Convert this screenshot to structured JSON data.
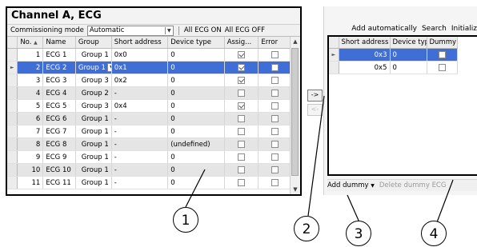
{
  "left_panel": {
    "title": "Channel A, ECG",
    "mode_label": "Commissioning mode",
    "mode_value": "Automatic",
    "all_on_label": "All ECG ON",
    "all_off_label": "All ECG OFF",
    "columns": [
      "No.",
      "Name",
      "Group",
      "Short address",
      "Device type",
      "Assig...",
      "Error"
    ],
    "rows": [
      {
        "no": "1",
        "name": "ECG 1",
        "group": "Group 1",
        "short_address": "0x0",
        "device_type": "0",
        "assigned": true,
        "error": false,
        "selected": false,
        "grey": false
      },
      {
        "no": "2",
        "name": "ECG 2",
        "group": "Group 1",
        "short_address": "0x1",
        "device_type": "0",
        "assigned": true,
        "error": false,
        "selected": true,
        "grey": false
      },
      {
        "no": "3",
        "name": "ECG 3",
        "group": "Group 3",
        "short_address": "0x2",
        "device_type": "0",
        "assigned": true,
        "error": false,
        "selected": false,
        "grey": false
      },
      {
        "no": "4",
        "name": "ECG 4",
        "group": "Group 2",
        "short_address": "-",
        "device_type": "0",
        "assigned": false,
        "error": false,
        "selected": false,
        "grey": true
      },
      {
        "no": "5",
        "name": "ECG 5",
        "group": "Group 3",
        "short_address": "0x4",
        "device_type": "0",
        "assigned": true,
        "error": false,
        "selected": false,
        "grey": false
      },
      {
        "no": "6",
        "name": "ECG 6",
        "group": "Group 1",
        "short_address": "-",
        "device_type": "0",
        "assigned": false,
        "error": false,
        "selected": false,
        "grey": true
      },
      {
        "no": "7",
        "name": "ECG 7",
        "group": "Group 1",
        "short_address": "-",
        "device_type": "0",
        "assigned": false,
        "error": false,
        "selected": false,
        "grey": false
      },
      {
        "no": "8",
        "name": "ECG 8",
        "group": "Group 1",
        "short_address": "-",
        "device_type": "(undefined)",
        "assigned": false,
        "error": false,
        "selected": false,
        "grey": true
      },
      {
        "no": "9",
        "name": "ECG 9",
        "group": "Group 1",
        "short_address": "-",
        "device_type": "0",
        "assigned": false,
        "error": false,
        "selected": false,
        "grey": false
      },
      {
        "no": "10",
        "name": "ECG 10",
        "group": "Group 1",
        "short_address": "-",
        "device_type": "0",
        "assigned": false,
        "error": false,
        "selected": false,
        "grey": true
      },
      {
        "no": "11",
        "name": "ECG 11",
        "group": "Group 1",
        "short_address": "-",
        "device_type": "0",
        "assigned": false,
        "error": false,
        "selected": false,
        "grey": false
      }
    ]
  },
  "transfer": {
    "right_label": "->",
    "left_label": "<-"
  },
  "right_panel": {
    "add_auto_label": "Add automatically",
    "search_label": "Search",
    "initialize_label": "Initializ",
    "columns": [
      "Short address",
      "Device type",
      "Dummy"
    ],
    "rows": [
      {
        "short_address": "0x3",
        "device_type": "0",
        "dummy": false,
        "selected": true
      },
      {
        "short_address": "0x5",
        "device_type": "0",
        "dummy": false,
        "selected": false
      }
    ]
  },
  "bottom_bar": {
    "add_dummy_label": "Add dummy",
    "delete_dummy_label": "Delete dummy ECG"
  },
  "callouts": [
    "1",
    "2",
    "3",
    "4"
  ],
  "colors": {
    "selection": "#3f6fd6",
    "grey_row": "#e5e5e5",
    "frame": "#000000"
  }
}
